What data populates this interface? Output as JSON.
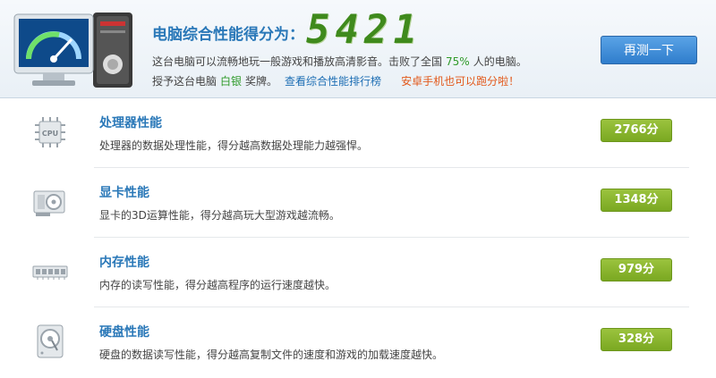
{
  "header": {
    "score_title": "电脑综合性能得分为：",
    "score_value": "5421",
    "desc_prefix": "这台电脑可以流畅地玩一般游戏和播放高清影音。击败了全国",
    "desc_percent": "75%",
    "desc_suffix": "人的电脑。",
    "award_prefix": "授予这台电脑",
    "award_medal": "白银",
    "award_suffix": "奖牌。",
    "ranking_link": "查看综合性能排行榜",
    "android_link": "安卓手机也可以跑分啦！",
    "retest_button": "再测一下"
  },
  "items": [
    {
      "name": "处理器性能",
      "desc": "处理器的数据处理性能，得分越高数据处理能力越强悍。",
      "score": "2766分",
      "icon": "cpu-icon",
      "icon_text": "CPU"
    },
    {
      "name": "显卡性能",
      "desc": "显卡的3D运算性能，得分越高玩大型游戏越流畅。",
      "score": "1348分",
      "icon": "graphics-card-icon"
    },
    {
      "name": "内存性能",
      "desc": "内存的读写性能，得分越高程序的运行速度越快。",
      "score": "979分",
      "icon": "memory-icon"
    },
    {
      "name": "硬盘性能",
      "desc": "硬盘的数据读写性能，得分越高复制文件的速度和游戏的加载速度越快。",
      "score": "328分",
      "icon": "hard-disk-icon"
    }
  ],
  "colors": {
    "accent_blue": "#2a78b8",
    "score_green": "#3f8a1c",
    "badge_green": "#8ab530",
    "link_orange": "#e2581a"
  }
}
